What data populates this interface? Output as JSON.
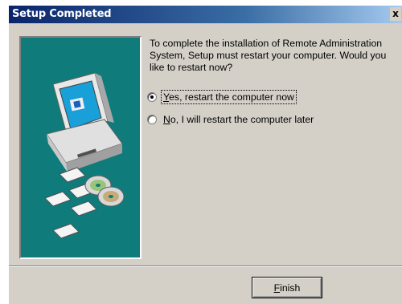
{
  "window": {
    "title": "Setup Completed",
    "close_glyph": "x"
  },
  "message": {
    "text": "To complete the installation of Remote Administration System, Setup must restart your computer. Would you like to restart now?"
  },
  "options": [
    {
      "mnemonic": "Y",
      "rest": "es, restart the computer now",
      "selected": true
    },
    {
      "mnemonic": "N",
      "rest": "o, I will restart the computer later",
      "selected": false
    }
  ],
  "finish_button": {
    "mnemonic": "F",
    "rest": "inish"
  },
  "colors": {
    "title_gradient_start": "#0a246a",
    "title_gradient_end": "#a6caf0",
    "dialog_face": "#d4d0c8",
    "art_background": "#0f7b7b"
  },
  "icons": {
    "art": "computer-with-disks-icon",
    "close": "close-icon"
  }
}
